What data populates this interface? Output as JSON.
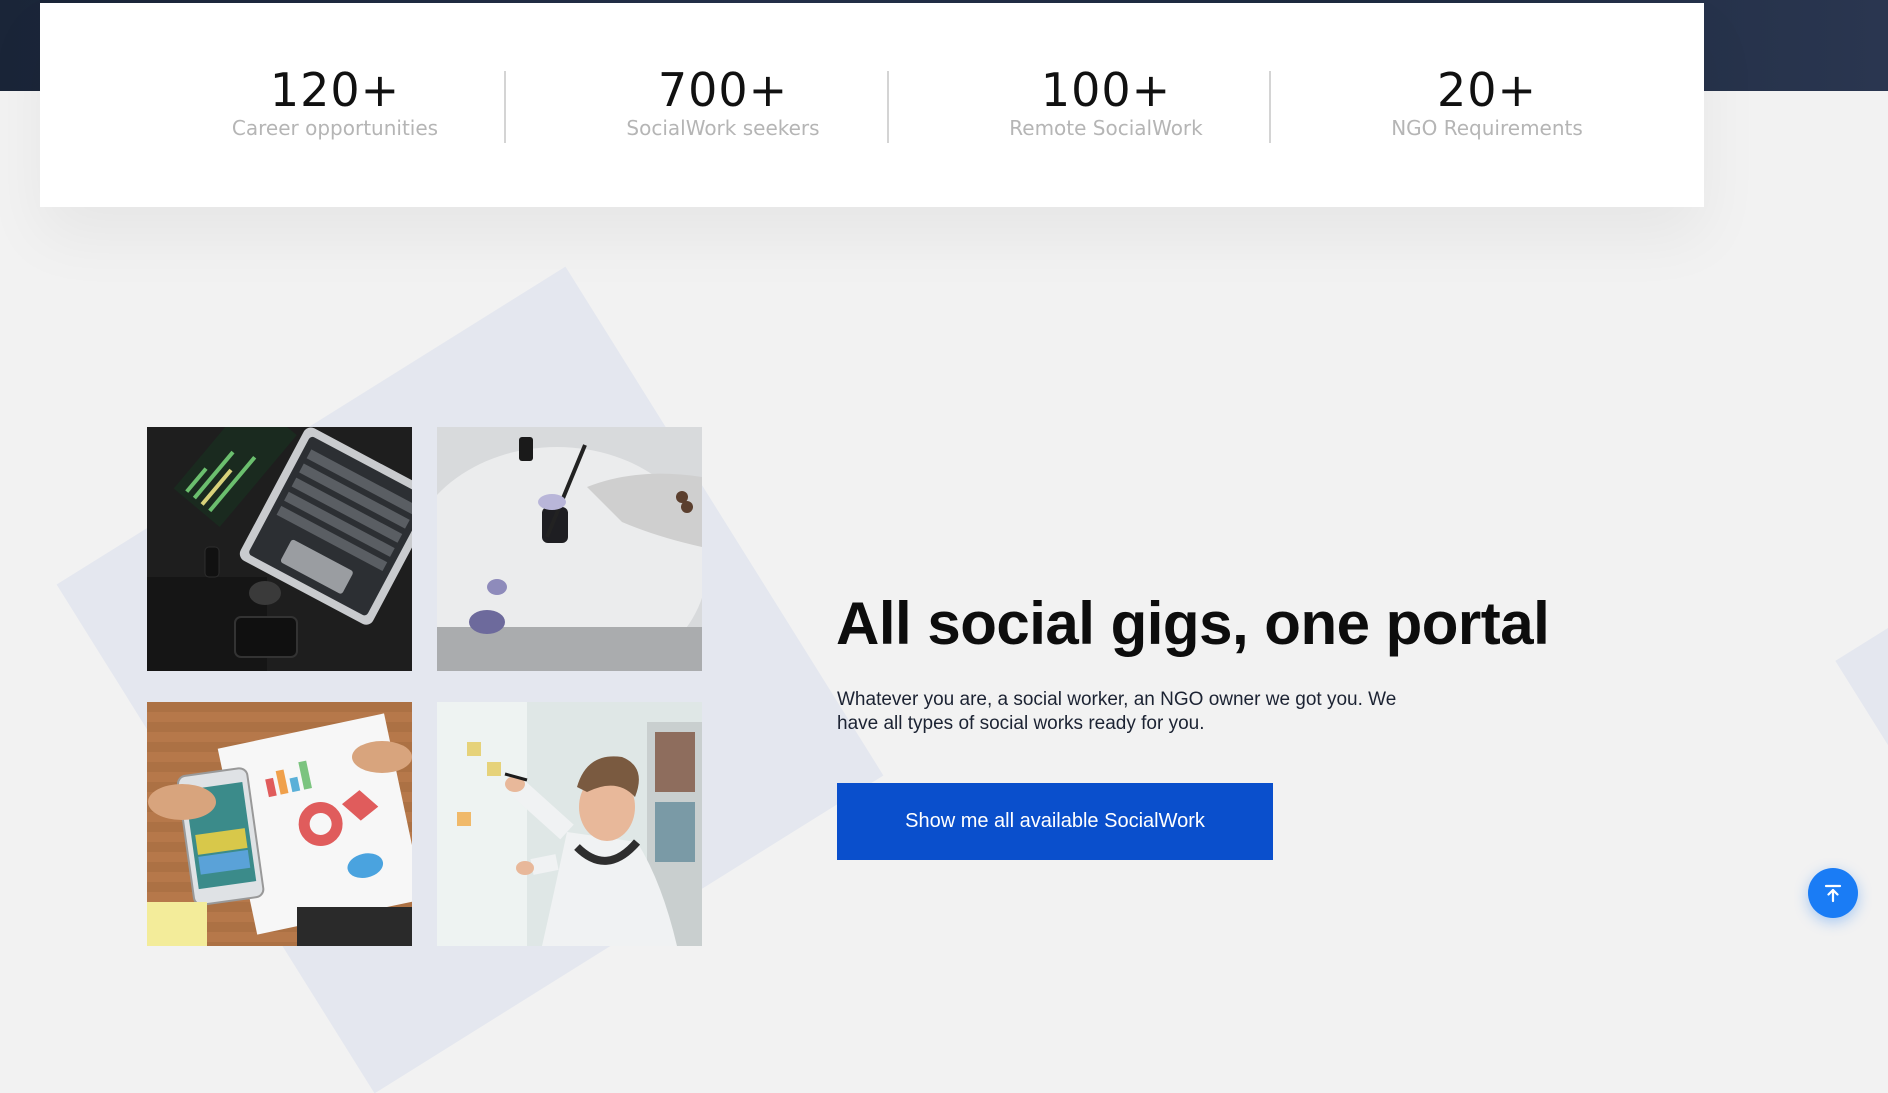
{
  "stats": [
    {
      "number": "120+",
      "label": "Career opportunities"
    },
    {
      "number": "700+",
      "label": "SocialWork seekers"
    },
    {
      "number": "100+",
      "label": "Remote SocialWork"
    },
    {
      "number": "20+",
      "label": "NGO Requirements"
    }
  ],
  "feature": {
    "title": "All social gigs, one portal",
    "description": "Whatever you are, a social worker, an NGO owner we got you. We have all types of social works ready for you.",
    "cta_label": "Show me all available SocialWork"
  },
  "icons": {
    "scroll_top": "arrow-up-to-line-icon"
  },
  "colors": {
    "primary": "#0a4fcc",
    "scroll_button": "#1a7cf5",
    "hero_band": "#1d2a3f",
    "page_background": "#f2f2f2",
    "stat_label": "#b5b5b5"
  }
}
